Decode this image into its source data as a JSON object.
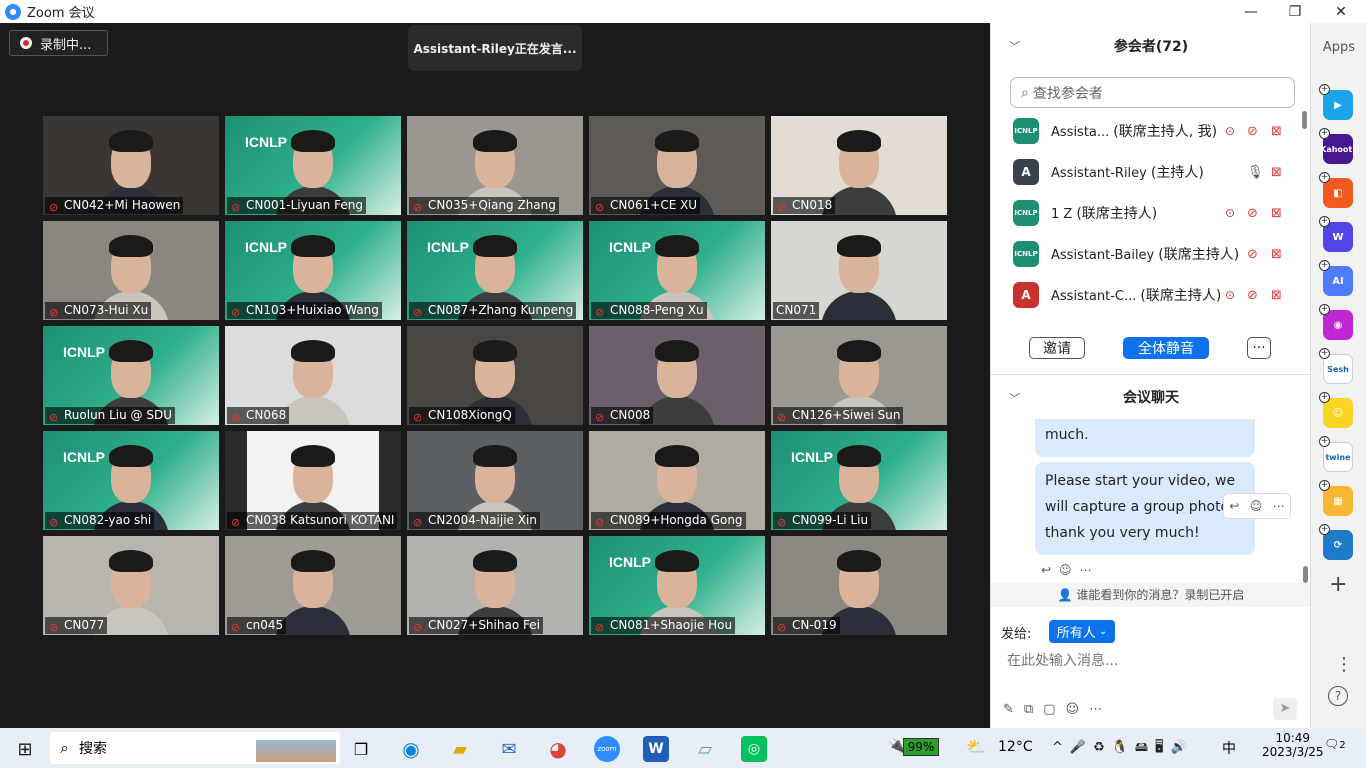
{
  "window": {
    "title": "Zoom 会议",
    "logo": "zoom"
  },
  "recording": {
    "label": "录制中..."
  },
  "speaking_banner": "Assistant-Riley正在发言...",
  "tiles": [
    {
      "name": "CN042+Mi Haowen",
      "muted": true
    },
    {
      "name": "CN001-Liyuan Feng",
      "muted": true
    },
    {
      "name": "CN035+Qiang Zhang",
      "muted": true
    },
    {
      "name": "CN061+CE XU",
      "muted": true
    },
    {
      "name": "CN018",
      "muted": true
    },
    {
      "name": "CN073-Hui Xu",
      "muted": true
    },
    {
      "name": "CN103+Huixiao Wang",
      "muted": true
    },
    {
      "name": "CN087+Zhang Kunpeng",
      "muted": true
    },
    {
      "name": "CN088-Peng Xu",
      "muted": true
    },
    {
      "name": "CN071",
      "muted": false
    },
    {
      "name": "Ruolun Liu @ SDU",
      "muted": true
    },
    {
      "name": "CN068",
      "muted": true
    },
    {
      "name": "CN108XiongQ",
      "muted": true
    },
    {
      "name": "CN008",
      "muted": true
    },
    {
      "name": "CN126+Siwei Sun",
      "muted": true
    },
    {
      "name": "CN082-yao shi",
      "muted": true
    },
    {
      "name": "CN038 Katsunori KOTANI",
      "muted": true
    },
    {
      "name": "CN2004-Naijie Xin",
      "muted": true
    },
    {
      "name": "CN089+Hongda Gong",
      "muted": true
    },
    {
      "name": "CN099-Li Liu",
      "muted": true
    },
    {
      "name": "CN077",
      "muted": true
    },
    {
      "name": "cn045",
      "muted": true
    },
    {
      "name": "CN027+Shihao Fei",
      "muted": true
    },
    {
      "name": "CN081+Shaojie Hou",
      "muted": true
    },
    {
      "name": "CN-019",
      "muted": true
    }
  ],
  "banner_text": "ICNLP",
  "participants": {
    "title": "参会者(72)",
    "search_placeholder": "查找参会者",
    "list": [
      {
        "name": "Assista...",
        "role": "(联席主持人, 我)",
        "avatar": "ICNLP",
        "color": "#1d8f73"
      },
      {
        "name": "Assistant-Riley",
        "role": "(主持人)",
        "avatar": "A",
        "color": "#39414d"
      },
      {
        "name": "1 Z",
        "role": "(联席主持人)",
        "avatar": "ICNLP",
        "color": "#1d8f73"
      },
      {
        "name": "Assistant-Bailey",
        "role": "(联席主持人)",
        "avatar": "ICNLP",
        "color": "#1d8f73"
      },
      {
        "name": "Assistant-C...",
        "role": "(联席主持人)",
        "avatar": "A",
        "color": "#c8322c"
      }
    ],
    "invite": "邀请",
    "mute_all": "全体静音",
    "more": "···"
  },
  "chat": {
    "title": "会议聊天",
    "messages": [
      "much.",
      "Please start your video, we will capture a group photo, thank you very much!"
    ],
    "notice": "谁能看到你的消息？录制已开启",
    "send_to_label": "发给:",
    "send_to_value": "所有人",
    "input_placeholder": "在此处输入消息..."
  },
  "apps": {
    "title": "Apps",
    "items": [
      "Kahoot!",
      "Sesh",
      "twine",
      "W"
    ]
  },
  "taskbar": {
    "search": "搜索",
    "battery": "99%",
    "temp": "12°C",
    "ime": "中",
    "time": "10:49",
    "date": "2023/3/25",
    "notify": "2"
  }
}
